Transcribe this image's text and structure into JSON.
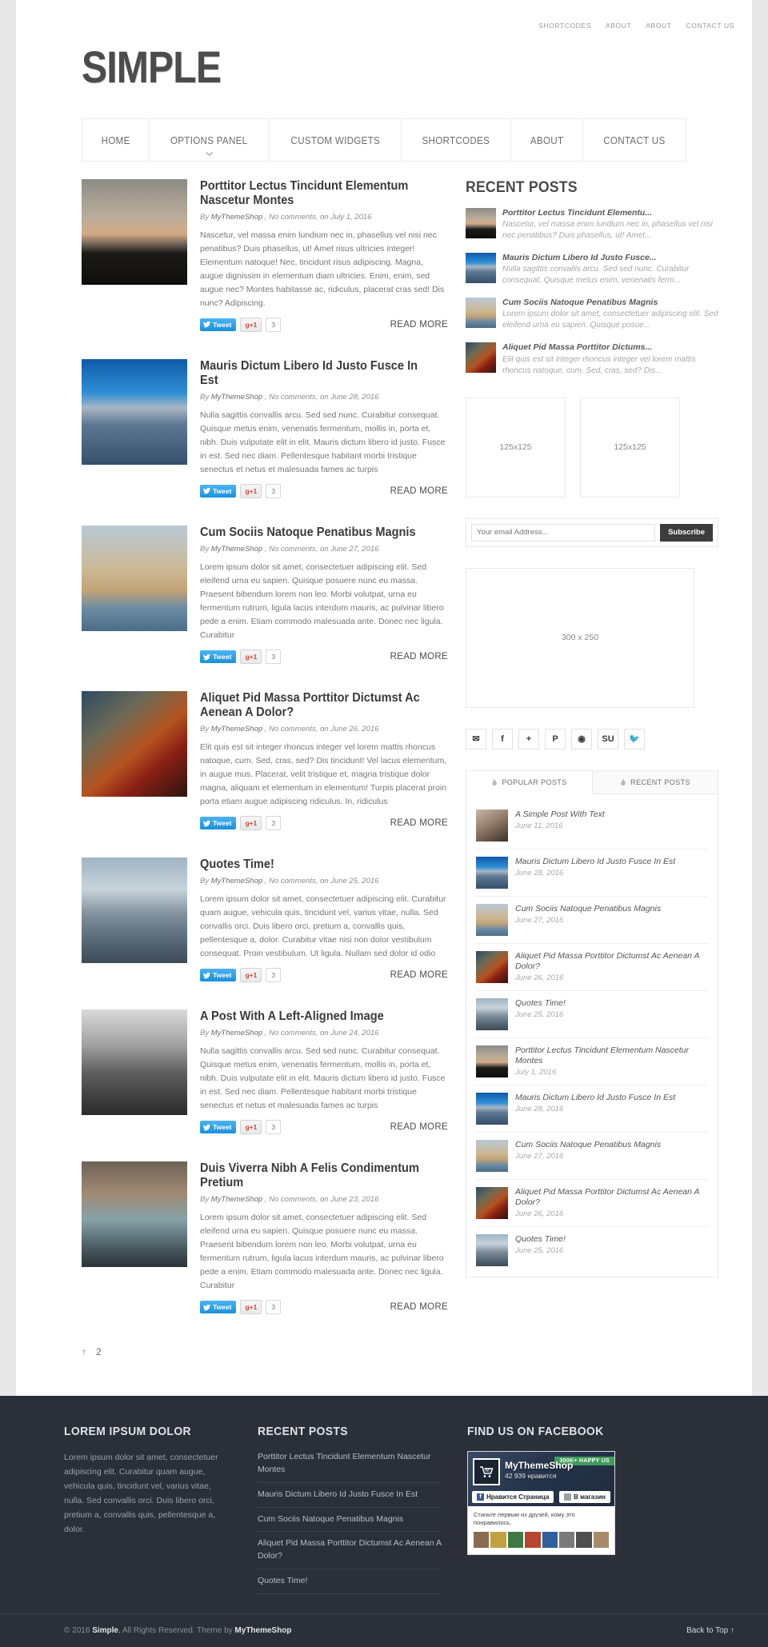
{
  "topnav": [
    {
      "label": "SHORTCODES"
    },
    {
      "label": "ABOUT"
    },
    {
      "label": "ABOUT"
    },
    {
      "label": "CONTACT US"
    }
  ],
  "logo": "SIMPLE",
  "mainmenu": [
    {
      "label": "HOME",
      "has_dropdown": false
    },
    {
      "label": "OPTIONS PANEL",
      "has_dropdown": true
    },
    {
      "label": "CUSTOM WIDGETS",
      "has_dropdown": false
    },
    {
      "label": "SHORTCODES",
      "has_dropdown": false
    },
    {
      "label": "ABOUT",
      "has_dropdown": false
    },
    {
      "label": "CONTACT US",
      "has_dropdown": false
    }
  ],
  "posts": [
    {
      "title": "Porttitor Lectus Tincidunt Elementum Nascetur Montes",
      "author": "MyThemeShop",
      "comments": "No comments",
      "date": "July 1, 2016",
      "excerpt": "Nascetur, vel massa enim lundium nec in, phasellus vel nisi nec penatibus? Duis phasellus, ut! Amet risus ultricies integer! Elementum natoque! Nec, tincidunt risus adipiscing. Magna, augue dignissim in elementum diam ultricies. Enim, enim, sed augue nec? Montes habitasse ac, ridiculus, placerat cras sed! Dis nunc? Adipiscing.",
      "tweet": "Tweet",
      "gplus": "g+1",
      "count": "3",
      "readmore": "READ MORE",
      "image": "img-sunset"
    },
    {
      "title": "Mauris Dictum Libero Id Justo Fusce In Est",
      "author": "MyThemeShop",
      "comments": "No comments",
      "date": "June 28, 2016",
      "excerpt": "Nulla sagittis convallis arcu. Sed sed nunc. Curabitur consequat. Quisque metus enim, venenatis fermentum, mollis in, porta et, nibh. Duis vulputate elit in elit. Mauris dictum libero id justo. Fusce in est. Sed nec diam. Pellentesque habitant morbi tristique senectus et netus et malesuada fames ac turpis",
      "tweet": "Tweet",
      "gplus": "g+1",
      "count": "3",
      "readmore": "READ MORE",
      "image": "img-lighthouse"
    },
    {
      "title": "Cum Sociis Natoque Penatibus Magnis",
      "author": "MyThemeShop",
      "comments": "No comments",
      "date": "June 27, 2016",
      "excerpt": "Lorem ipsum dolor sit amet, consectetuer adipiscing elit. Sed eleifend urna eu sapien. Quisque posuere nunc eu massa. Praesent bibendum lorem non leo. Morbi volutpat, urna eu fermentum rutrum, ligula lacus interdum mauris, ac pulvinar libero pede a enim. Etiam commodo malesuada ante. Donec nec ligula. Curabitur",
      "tweet": "Tweet",
      "gplus": "g+1",
      "count": "3",
      "readmore": "READ MORE",
      "image": "img-tower"
    },
    {
      "title": "Aliquet Pid Massa Porttitor Dictumst Ac Aenean A Dolor?",
      "author": "MyThemeShop",
      "comments": "No comments",
      "date": "June 26, 2016",
      "excerpt": "Elit quis est sit integer rhoncus integer vel lorem mattis rhoncus natoque, cum. Sed, cras, sed? Dis tincidunt! Vel lacus elementum, in augue mus. Placerat, velit tristique et, magna tristique dolor magna, aliquam et elementum in elementum! Turpis placerat proin porta etiam augue adipiscing ridiculus. In, ridiculus",
      "tweet": "Tweet",
      "gplus": "g+1",
      "count": "3",
      "readmore": "READ MORE",
      "image": "img-rose"
    },
    {
      "title": "Quotes Time!",
      "author": "MyThemeShop",
      "comments": "No comments",
      "date": "June 25, 2016",
      "excerpt": "Lorem ipsum dolor sit amet, consectetuer adipiscing elit. Curabitur quam augue, vehicula quis, tincidunt vel, varius vitae, nulla. Sed convallis orci. Duis libero orci, pretium a, convallis quis, pellentesque a, dolor. Curabitur vitae nisi non dolor vestibulum consequat. Proin vestibulum. Ut ligula. Nullam sed dolor id odio",
      "tweet": "Tweet",
      "gplus": "g+1",
      "count": "3",
      "readmore": "READ MORE",
      "image": "img-quotes"
    },
    {
      "title": "A Post With A Left-Aligned Image",
      "author": "MyThemeShop",
      "comments": "No comments",
      "date": "June 24, 2016",
      "excerpt": "Nulla sagittis convallis arcu. Sed sed nunc. Curabitur consequat. Quisque metus enim, venenatis fermentum, mollis in, porta et, nibh. Duis vulputate elit in elit. Mauris dictum libero id justo. Fusce in est. Sed nec diam. Pellentesque habitant morbi tristique senectus et netus et malesuada fames ac turpis",
      "tweet": "Tweet",
      "gplus": "g+1",
      "count": "3",
      "readmore": "READ MORE",
      "image": "img-bw"
    },
    {
      "title": "Duis Viverra Nibh A Felis Condimentum Pretium",
      "author": "MyThemeShop",
      "comments": "No comments",
      "date": "June 23, 2016",
      "excerpt": "Lorem ipsum dolor sit amet, consectetuer adipiscing elit. Sed eleifend urna eu sapien. Quisque posuere nunc eu massa. Praesent bibendum lorem non leo. Morbi volutpat, urna eu fermentum rutrum, ligula lacus interdum mauris, ac pulvinar libero pede a enim. Etiam commodo malesuada ante. Donec nec ligula. Curabitur",
      "tweet": "Tweet",
      "gplus": "g+1",
      "count": "3",
      "readmore": "READ MORE",
      "image": "img-girl"
    }
  ],
  "pagination": {
    "prev": "↑",
    "page2": "2"
  },
  "sidebar": {
    "recent_title": "RECENT POSTS",
    "recent_posts": [
      {
        "title": "Porttitor Lectus Tincidunt Elementu...",
        "excerpt": "Nascetur, vel massa enim lundium nec in, phasellus vel nisi nec penatibus? Duis phasellus, ut! Amet...",
        "image": "img-sunset"
      },
      {
        "title": "Mauris Dictum Libero Id Justo Fusce...",
        "excerpt": "Nulla sagittis convallis arcu. Sed sed nunc. Curabitur consequat. Quisque metus enim, venenatis ferm...",
        "image": "img-lighthouse"
      },
      {
        "title": "Cum Sociis Natoque Penatibus Magnis",
        "excerpt": "Lorem ipsum dolor sit amet, consectetuer adipiscing elit. Sed eleifend urna eu sapien. Quisque posue...",
        "image": "img-tower"
      },
      {
        "title": "Aliquet Pid Massa Porttitor Dictums...",
        "excerpt": "Elit quis est sit integer rhoncus integer vel lorem mattis rhoncus natoque, cum. Sed, cras, sed? Dis...",
        "image": "img-rose"
      }
    ],
    "ads": [
      {
        "label": "125x125"
      },
      {
        "label": "125x125"
      }
    ],
    "ad_large": "300 x 250",
    "subscribe": {
      "placeholder": "Your email Address...",
      "button": "Subscribe"
    },
    "social": [
      {
        "name": "email-icon",
        "glyph": "✉"
      },
      {
        "name": "facebook-icon",
        "glyph": "f"
      },
      {
        "name": "google-plus-icon",
        "glyph": "+"
      },
      {
        "name": "pinterest-icon",
        "glyph": "P"
      },
      {
        "name": "rss-icon",
        "glyph": "◉"
      },
      {
        "name": "stumbleupon-icon",
        "glyph": "SU"
      },
      {
        "name": "twitter-icon",
        "glyph": "🐦"
      }
    ],
    "tabs": [
      {
        "label": "POPULAR POSTS",
        "active": true
      },
      {
        "label": "RECENT POSTS",
        "active": false
      }
    ],
    "tab_posts": [
      {
        "title": "A Simple Post With Text",
        "date": "June 11, 2016",
        "image": "img-text"
      },
      {
        "title": "Mauris Dictum Libero Id Justo Fusce In Est",
        "date": "June 28, 2016",
        "image": "img-lighthouse"
      },
      {
        "title": "Cum Sociis Natoque Penatibus Magnis",
        "date": "June 27, 2016",
        "image": "img-tower"
      },
      {
        "title": "Aliquet Pid Massa Porttitor Dictumst Ac Aenean A Dolor?",
        "date": "June 26, 2016",
        "image": "img-rose"
      },
      {
        "title": "Quotes Time!",
        "date": "June 25, 2016",
        "image": "img-quotes"
      },
      {
        "title": "Porttitor Lectus Tincidunt Elementum Nascetur Montes",
        "date": "July 1, 2016",
        "image": "img-sunset"
      },
      {
        "title": "Mauris Dictum Libero Id Justo Fusce In Est",
        "date": "June 28, 2016",
        "image": "img-lighthouse"
      },
      {
        "title": "Cum Sociis Natoque Penatibus Magnis",
        "date": "June 27, 2016",
        "image": "img-tower"
      },
      {
        "title": "Aliquet Pid Massa Porttitor Dictumst Ac Aenean A Dolor?",
        "date": "June 26, 2016",
        "image": "img-rose"
      },
      {
        "title": "Quotes Time!",
        "date": "June 25, 2016",
        "image": "img-quotes"
      }
    ]
  },
  "footer": {
    "col1": {
      "title": "LOREM IPSUM DOLOR",
      "text": "Lorem ipsum dolor sit amet, consectetuer adipiscing elit. Curabitur quam augue, vehicula quis, tincidunt vel, varius vitae, nulla. Sed convallis orci. Duis libero orci, pretium a, convallis quis, pellentesque a, dolor."
    },
    "col2": {
      "title": "RECENT POSTS",
      "links": [
        "Porttitor Lectus Tincidunt Elementum Nascetur Montes",
        "Mauris Dictum Libero Id Justo Fusce In Est",
        "Cum Sociis Natoque Penatibus Magnis",
        "Aliquet Pid Massa Porttitor Dictumst Ac Aenean A Dolor?",
        "Quotes Time!"
      ]
    },
    "col3": {
      "title": "FIND US ON FACEBOOK",
      "page_name": "MyThemeShop",
      "likes": "42 939 нравится",
      "badge": "300K+ HAPPY US",
      "like_button": "Нравится Страница",
      "shop_button": "В магазин",
      "note": "Станьте первым из друзей, кому это понравилось."
    },
    "bottom": {
      "copy_prefix": "© 2016",
      "site": "Simple",
      "rights": ", All Rights Reserved. Theme by",
      "author": "MyThemeShop",
      "backtotop": "Back to Top ↑"
    }
  }
}
